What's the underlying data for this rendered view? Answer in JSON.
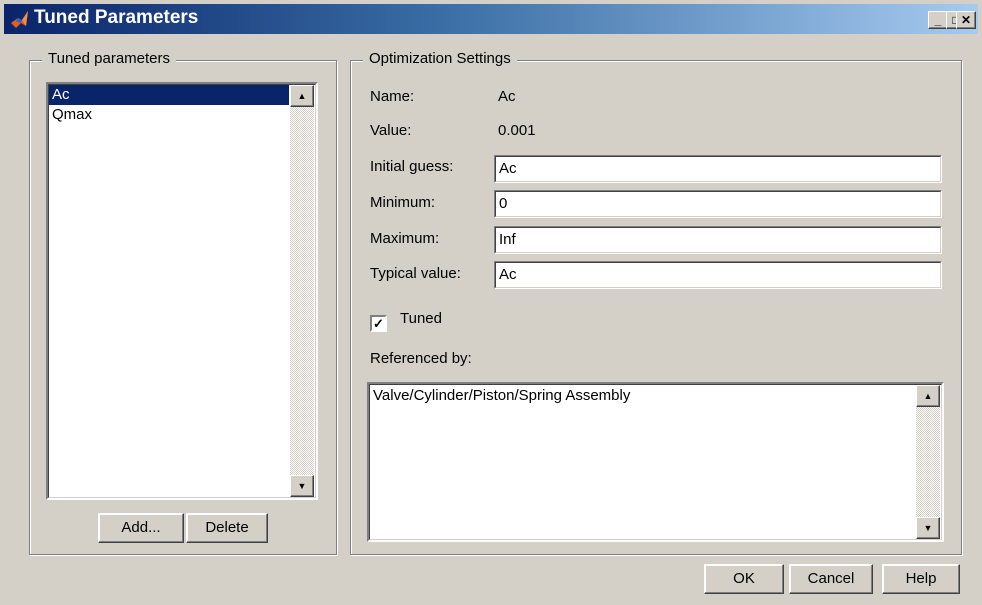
{
  "window": {
    "title": "Tuned Parameters",
    "controls": {
      "minimize": "_",
      "maximize": "□",
      "close": "✕"
    }
  },
  "tuned_group": {
    "label": "Tuned parameters",
    "items": [
      {
        "label": "Ac",
        "selected": true
      },
      {
        "label": "Qmax",
        "selected": false
      }
    ],
    "add_label": "Add...",
    "delete_label": "Delete"
  },
  "optimization": {
    "label": "Optimization Settings",
    "name_label": "Name:",
    "name_value": "Ac",
    "value_label": "Value:",
    "value_value": "0.001",
    "initial_guess_label": "Initial guess:",
    "initial_guess_value": "Ac",
    "minimum_label": "Minimum:",
    "minimum_value": "0",
    "maximum_label": "Maximum:",
    "maximum_value": "Inf",
    "typical_label": "Typical value:",
    "typical_value": "Ac",
    "tuned_label": "Tuned",
    "tuned_checked": true,
    "referenced_label": "Referenced by:",
    "referenced_items": [
      "Valve/Cylinder/Piston/Spring Assembly"
    ]
  },
  "footer": {
    "ok": "OK",
    "cancel": "Cancel",
    "help": "Help"
  },
  "colors": {
    "selection": "#0a246a",
    "face": "#d4d0c8",
    "title_start": "#0a246a",
    "title_end": "#a6caf0"
  }
}
